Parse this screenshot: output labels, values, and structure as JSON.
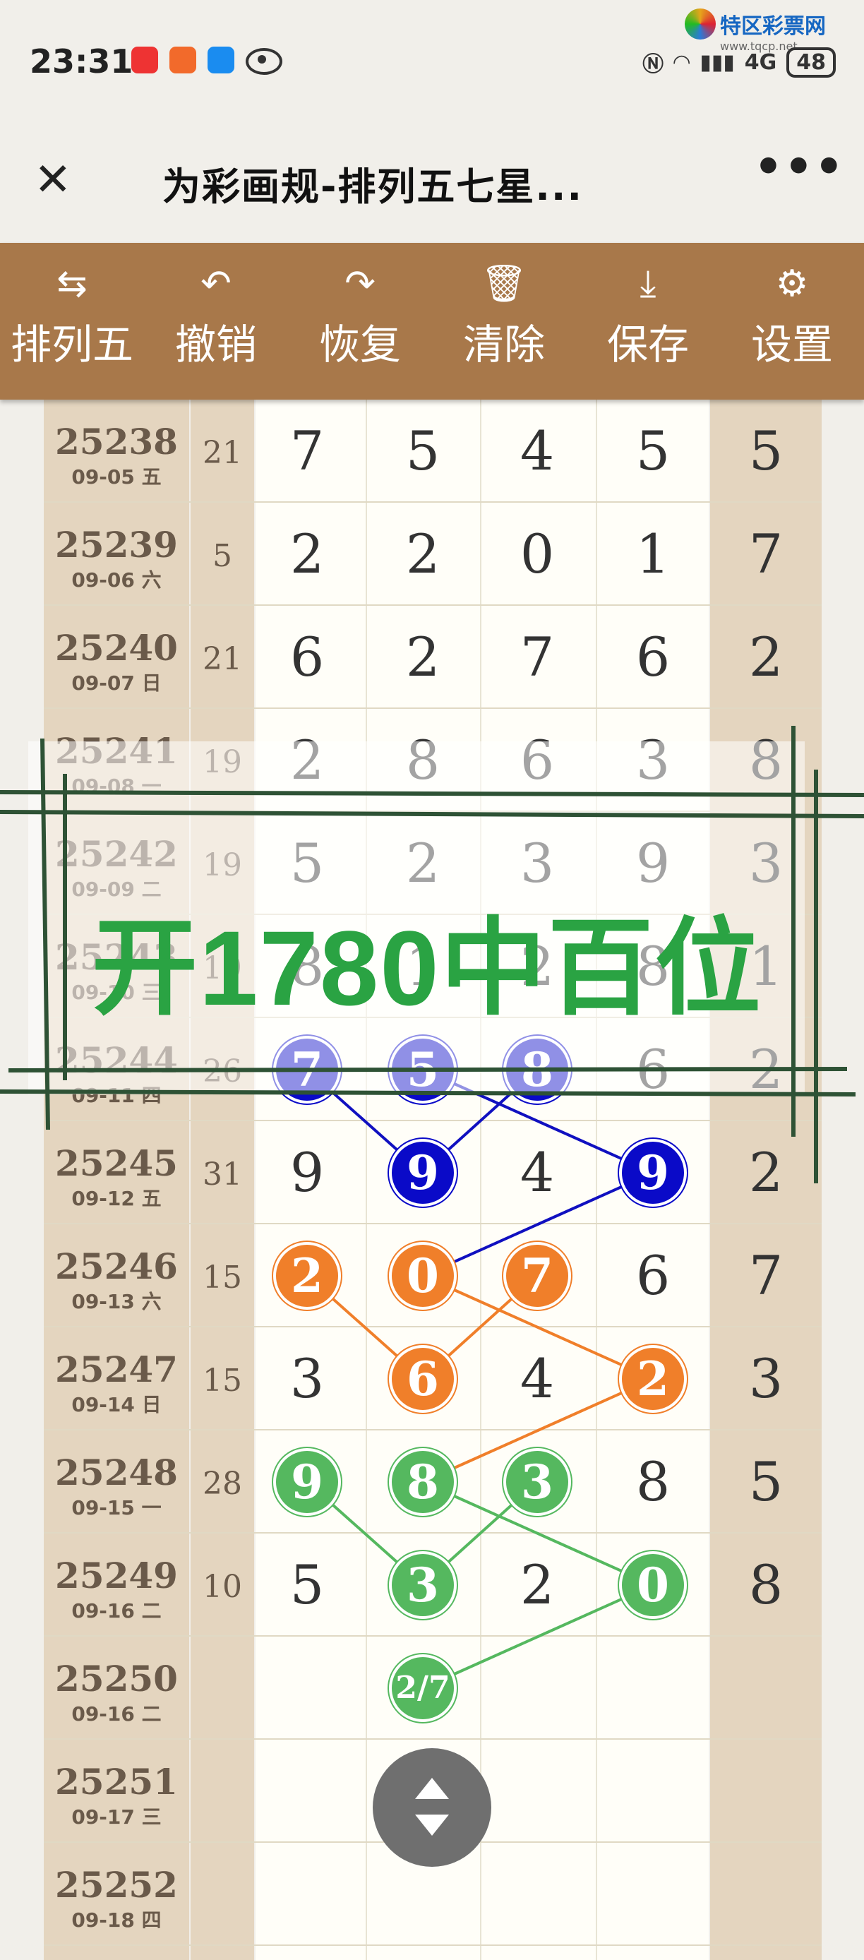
{
  "status": {
    "time": "23:31",
    "battery": "48",
    "network": "4G",
    "watermark": "特区彩票网",
    "watermark_url": "www.tqcp.net"
  },
  "titlebar": {
    "title": "为彩画规-排列五七星..."
  },
  "toolbar": {
    "items": [
      {
        "label": "排列五",
        "icon": "swap-icon"
      },
      {
        "label": "撤销",
        "icon": "undo-icon"
      },
      {
        "label": "恢复",
        "icon": "redo-icon"
      },
      {
        "label": "清除",
        "icon": "trash-icon"
      },
      {
        "label": "保存",
        "icon": "download-icon"
      },
      {
        "label": "设置",
        "icon": "gear-icon"
      }
    ]
  },
  "rows": [
    {
      "id": "25238",
      "date": "09-05 五",
      "sum": "21",
      "digits": [
        "7",
        "5",
        "4",
        "5"
      ],
      "extra": "5"
    },
    {
      "id": "25239",
      "date": "09-06 六",
      "sum": "5",
      "digits": [
        "2",
        "2",
        "0",
        "1"
      ],
      "extra": "7"
    },
    {
      "id": "25240",
      "date": "09-07 日",
      "sum": "21",
      "digits": [
        "6",
        "2",
        "7",
        "6"
      ],
      "extra": "2"
    },
    {
      "id": "25241",
      "date": "09-08 一",
      "sum": "19",
      "digits": [
        "2",
        "8",
        "6",
        "3"
      ],
      "extra": "8"
    },
    {
      "id": "25242",
      "date": "09-09 二",
      "sum": "19",
      "digits": [
        "5",
        "2",
        "3",
        "9"
      ],
      "extra": "3"
    },
    {
      "id": "25243",
      "date": "09-10 三",
      "sum": "19",
      "digits": [
        "8",
        "1",
        "2",
        "8"
      ],
      "extra": "1"
    },
    {
      "id": "25244",
      "date": "09-11 四",
      "sum": "26",
      "digits": [
        "7",
        "5",
        "8",
        "6"
      ],
      "extra": "2"
    },
    {
      "id": "25245",
      "date": "09-12 五",
      "sum": "31",
      "digits": [
        "9",
        "9",
        "4",
        "9"
      ],
      "extra": "2"
    },
    {
      "id": "25246",
      "date": "09-13 六",
      "sum": "15",
      "digits": [
        "2",
        "0",
        "7",
        "6"
      ],
      "extra": "7"
    },
    {
      "id": "25247",
      "date": "09-14 日",
      "sum": "15",
      "digits": [
        "3",
        "6",
        "4",
        "2"
      ],
      "extra": "3"
    },
    {
      "id": "25248",
      "date": "09-15 一",
      "sum": "28",
      "digits": [
        "9",
        "8",
        "3",
        "8"
      ],
      "extra": "5"
    },
    {
      "id": "25249",
      "date": "09-16 二",
      "sum": "10",
      "digits": [
        "5",
        "3",
        "2",
        "0"
      ],
      "extra": "8"
    },
    {
      "id": "25250",
      "date": "09-16 二",
      "sum": "",
      "digits": [
        "",
        "2/7",
        "",
        ""
      ],
      "extra": ""
    },
    {
      "id": "25251",
      "date": "09-17 三",
      "sum": "",
      "digits": [
        "",
        "",
        "",
        ""
      ],
      "extra": ""
    },
    {
      "id": "25252",
      "date": "09-18 四",
      "sum": "",
      "digits": [
        "",
        "",
        "",
        ""
      ],
      "extra": ""
    }
  ],
  "balls": [
    {
      "row": 6,
      "col": 0,
      "color": "blue"
    },
    {
      "row": 6,
      "col": 1,
      "color": "blue"
    },
    {
      "row": 6,
      "col": 2,
      "color": "blue"
    },
    {
      "row": 7,
      "col": 1,
      "color": "blue"
    },
    {
      "row": 7,
      "col": 3,
      "color": "blue"
    },
    {
      "row": 8,
      "col": 0,
      "color": "orange"
    },
    {
      "row": 8,
      "col": 1,
      "color": "orange"
    },
    {
      "row": 8,
      "col": 2,
      "color": "orange"
    },
    {
      "row": 9,
      "col": 1,
      "color": "orange"
    },
    {
      "row": 9,
      "col": 3,
      "color": "orange"
    },
    {
      "row": 10,
      "col": 0,
      "color": "green"
    },
    {
      "row": 10,
      "col": 1,
      "color": "green"
    },
    {
      "row": 10,
      "col": 2,
      "color": "green"
    },
    {
      "row": 11,
      "col": 1,
      "color": "green"
    },
    {
      "row": 11,
      "col": 3,
      "color": "green"
    },
    {
      "row": 12,
      "col": 1,
      "color": "green"
    }
  ],
  "links": [
    {
      "color": "#1010c0",
      "a": [
        6,
        0
      ],
      "b": [
        7,
        1
      ]
    },
    {
      "color": "#1010c0",
      "a": [
        7,
        1
      ],
      "b": [
        6,
        2
      ]
    },
    {
      "color": "#1010c0",
      "a": [
        6,
        1
      ],
      "b": [
        7,
        3
      ]
    },
    {
      "color": "#1010c0",
      "a": [
        7,
        3
      ],
      "b": [
        8,
        1
      ]
    },
    {
      "color": "#f07f2a",
      "a": [
        8,
        0
      ],
      "b": [
        9,
        1
      ]
    },
    {
      "color": "#f07f2a",
      "a": [
        9,
        1
      ],
      "b": [
        8,
        2
      ]
    },
    {
      "color": "#f07f2a",
      "a": [
        8,
        1
      ],
      "b": [
        9,
        3
      ]
    },
    {
      "color": "#f07f2a",
      "a": [
        9,
        3
      ],
      "b": [
        10,
        1
      ]
    },
    {
      "color": "#55b85f",
      "a": [
        10,
        0
      ],
      "b": [
        11,
        1
      ]
    },
    {
      "color": "#55b85f",
      "a": [
        11,
        1
      ],
      "b": [
        10,
        2
      ]
    },
    {
      "color": "#55b85f",
      "a": [
        10,
        1
      ],
      "b": [
        11,
        3
      ]
    },
    {
      "color": "#55b85f",
      "a": [
        11,
        3
      ],
      "b": [
        12,
        1
      ]
    }
  ],
  "announcement": "开1780中百位",
  "colors": {
    "toolbar": "#a8784a",
    "accent_green": "#2aa343"
  }
}
